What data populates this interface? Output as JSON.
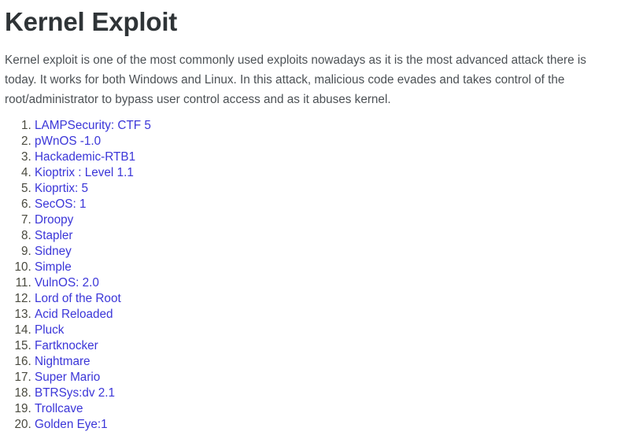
{
  "article": {
    "title": "Kernel Exploit",
    "intro": "Kernel exploit is one of the most commonly used exploits nowadays as it is the most advanced attack there is today. It works for both Windows and Linux. In this attack, malicious code evades and takes control of the root/administrator to bypass user control access and as it abuses kernel.",
    "list_type": "ordered-decimal",
    "items": [
      {
        "number": "1.",
        "label": "LAMPSecurity: CTF 5"
      },
      {
        "number": "2.",
        "label": "pWnOS -1.0"
      },
      {
        "number": "3.",
        "label": "Hackademic-RTB1"
      },
      {
        "number": "4.",
        "label": "Kioptrix : Level 1.1"
      },
      {
        "number": "5.",
        "label": "Kioprtix: 5"
      },
      {
        "number": "6.",
        "label": "SecOS: 1"
      },
      {
        "number": "7.",
        "label": "Droopy"
      },
      {
        "number": "8.",
        "label": "Stapler"
      },
      {
        "number": "9.",
        "label": "Sidney"
      },
      {
        "number": "10.",
        "label": "Simple"
      },
      {
        "number": "11.",
        "label": "VulnOS: 2.0"
      },
      {
        "number": "12.",
        "label": "Lord of the Root"
      },
      {
        "number": "13.",
        "label": "Acid Reloaded"
      },
      {
        "number": "14.",
        "label": "Pluck"
      },
      {
        "number": "15.",
        "label": "Fartknocker"
      },
      {
        "number": "16.",
        "label": "Nightmare"
      },
      {
        "number": "17.",
        "label": "Super Mario"
      },
      {
        "number": "18.",
        "label": "BTRSys:dv 2.1"
      },
      {
        "number": "19.",
        "label": "Trollcave"
      },
      {
        "number": "20.",
        "label": "Golden Eye:1"
      }
    ]
  },
  "colors": {
    "background": "#ffffff",
    "heading_text": "#2f3437",
    "body_text": "#4c5155",
    "link_text": "#3b36d8",
    "marker_text": "#4a4a3f"
  }
}
